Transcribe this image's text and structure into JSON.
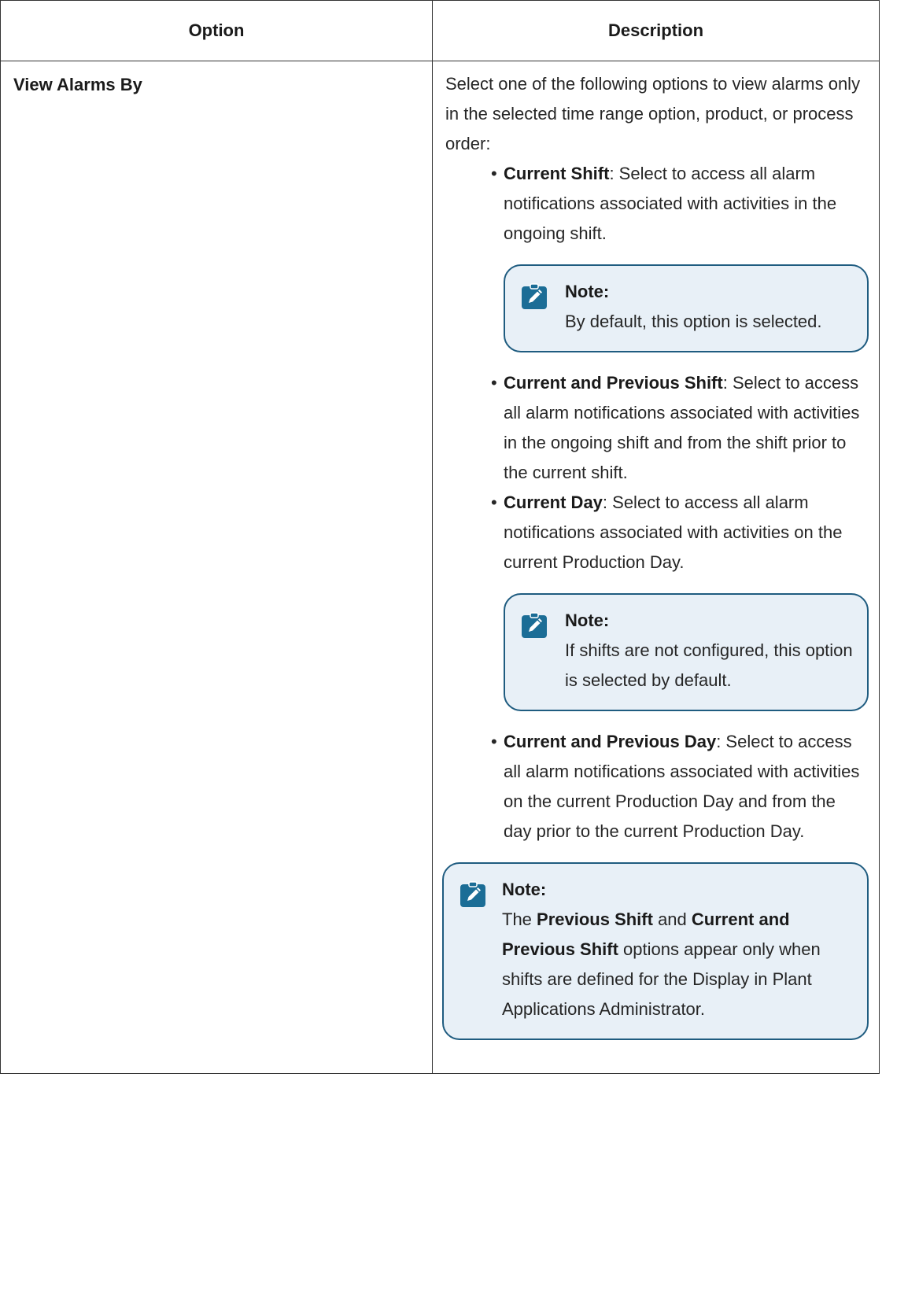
{
  "table": {
    "header_option": "Option",
    "header_description": "Description",
    "row": {
      "option_name": "View Alarms By",
      "intro": "Select one of the following options to view alarms only in the selected time range option, product, or process order:",
      "options": [
        {
          "label": "Current Shift",
          "text": ": Select to access all alarm notifications associated with activities in the ongoing shift.",
          "note": {
            "title": "Note:",
            "text": "By default, this option is selected."
          }
        },
        {
          "label": "Current and Previous Shift",
          "text": ": Select to access all alarm notifications associated with activities in the ongoing shift and from the shift prior to the current shift."
        },
        {
          "label": "Current Day",
          "text": ": Select to access all alarm notifications associated with activities on the current Production Day.",
          "note": {
            "title": "Note:",
            "text": "If shifts are not configured, this option is selected by default."
          }
        },
        {
          "label": "Current and Previous Day",
          "text": ": Select to access all alarm notifications associated with activities on the current Production Day and from the day prior to the current Production Day."
        }
      ],
      "bottom_note": {
        "title": "Note:",
        "part1": "The ",
        "bold1": "Previous Shift",
        "part2": " and ",
        "bold2": "Current and Previous Shift",
        "part3": " options appear only when shifts are defined for the Display in Plant Applications Administrator."
      }
    }
  },
  "icons": {
    "note": "note-pencil-icon"
  },
  "colors": {
    "note_background": "#e8f0f7",
    "note_border": "#1f5c80",
    "icon_fill": "#1b6d96"
  }
}
